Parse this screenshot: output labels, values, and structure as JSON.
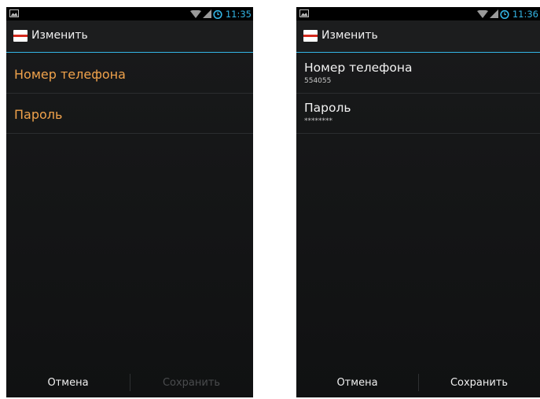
{
  "colors": {
    "accent": "#33b5e5",
    "pref_title_highlight": "#f0a24b",
    "disabled_text": "#4a4c4e"
  },
  "left": {
    "status_time": "11:35",
    "actionbar_title": "Изменить",
    "prefs": [
      {
        "title": "Номер телефона"
      },
      {
        "title": "Пароль"
      }
    ],
    "cancel_label": "Отмена",
    "save_label": "Сохранить"
  },
  "right": {
    "status_time": "11:36",
    "actionbar_title": "Изменить",
    "prefs": [
      {
        "title": "Номер телефона",
        "summary": "554055"
      },
      {
        "title": "Пароль",
        "summary": "********"
      }
    ],
    "cancel_label": "Отмена",
    "save_label": "Сохранить"
  }
}
